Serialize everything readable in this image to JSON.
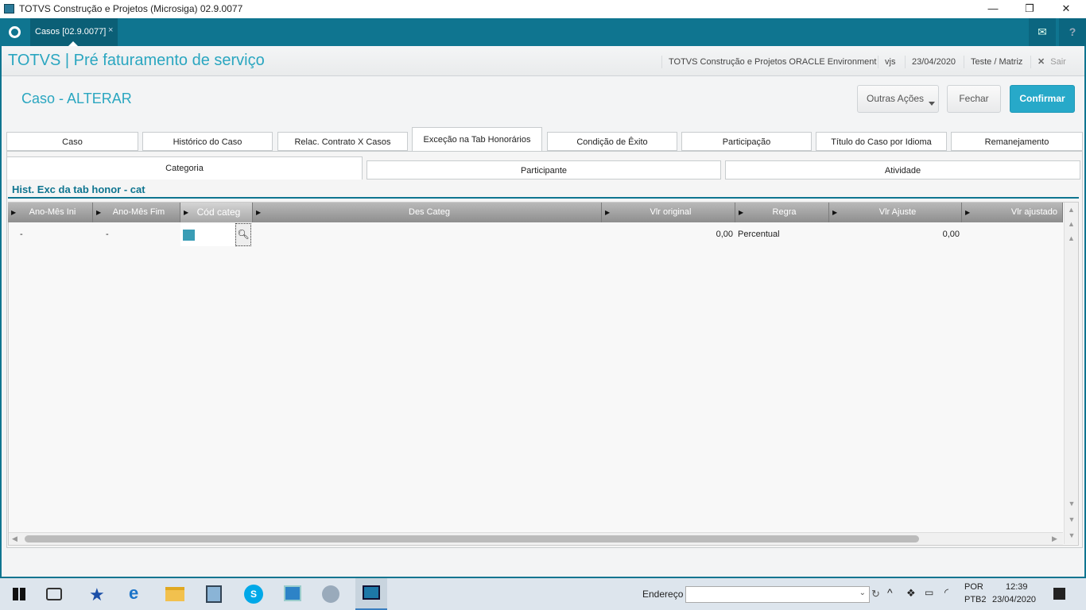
{
  "window": {
    "title": "TOTVS Construção e Projetos (Microsiga) 02.9.0077",
    "minimize": "—",
    "restore": "❐",
    "close": "✕"
  },
  "appbar": {
    "tab_label": "Casos [02.9.0077]",
    "tab_close": "×",
    "mail_icon": "✉",
    "help_icon": "?"
  },
  "header": {
    "title": "TOTVS | Pré faturamento de serviço",
    "environment": "TOTVS Construção e Projetos ORACLE Environment",
    "user": "vjs",
    "date": "23/04/2020",
    "branch": "Teste / Matriz",
    "exit_label": "Sair",
    "exit_icon": "✕"
  },
  "page": {
    "title": "Caso - ALTERAR",
    "other_actions": "Outras Ações",
    "close": "Fechar",
    "confirm": "Confirmar"
  },
  "tabs": [
    "Caso",
    "Histórico do Caso",
    "Relac. Contrato X Casos",
    "Exceção na Tab Honorários",
    "Condição de Êxito",
    "Participação",
    "Título do Caso por Idioma",
    "Remanejamento"
  ],
  "subtabs": [
    "Categoria",
    "Participante",
    "Atividade"
  ],
  "section": {
    "title": "Hist. Exc da tab honor - cat"
  },
  "grid": {
    "columns": [
      "Ano-Mês Ini",
      "Ano-Mês Fim",
      "Cód categ",
      "Des Categ",
      "Vlr original",
      "Regra",
      "Vlr Ajuste",
      "Vlr ajustado"
    ],
    "rows": [
      {
        "ano_mes_ini": "-",
        "ano_mes_fim": "-",
        "cod_categ": "",
        "des_categ": "",
        "vlr_original": "0,00",
        "regra": "Percentual",
        "vlr_ajuste": "0,00",
        "vlr_ajustado": ""
      }
    ]
  },
  "taskbar": {
    "address_label": "Endereço",
    "address_value": "",
    "lang1": "POR",
    "lang2": "PTB2",
    "time": "12:39",
    "date": "23/04/2020"
  },
  "colors": {
    "teal": "#0f7590",
    "accent": "#2aa6c0",
    "confirm": "#27a9c9"
  }
}
